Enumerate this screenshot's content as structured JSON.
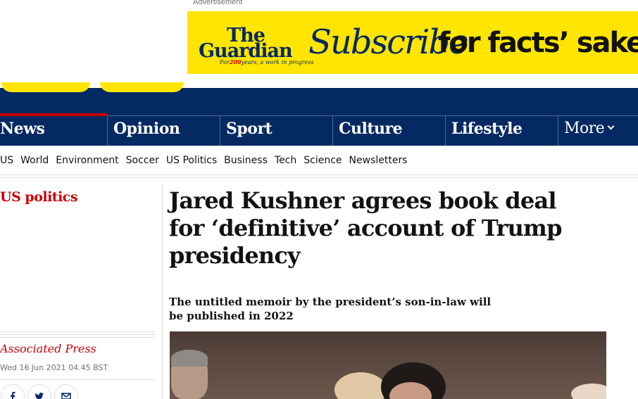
{
  "ad": {
    "label": "Advertisement",
    "logo_line1": "The",
    "logo_line2": "Guardian",
    "logo_tag_number": "200",
    "logo_tag_pre": "For",
    "logo_tag_post": "years, a work in progress",
    "headline_italic": "Subscribe",
    "headline_bold": "for facts’ sake",
    "background_color": "#ffe500"
  },
  "masthead": {
    "background_color": "#052962",
    "pillars": [
      {
        "label": "News",
        "active": true
      },
      {
        "label": "Opinion",
        "active": false
      },
      {
        "label": "Sport",
        "active": false
      },
      {
        "label": "Culture",
        "active": false
      },
      {
        "label": "Lifestyle",
        "active": false
      }
    ],
    "more_label": "More"
  },
  "subnav": {
    "items": [
      "US",
      "World",
      "Environment",
      "Soccer",
      "US Politics",
      "Business",
      "Tech",
      "Science",
      "Newsletters"
    ]
  },
  "article": {
    "section": "US politics",
    "headline": "Jared Kushner agrees book deal for ‘definitive’ account of Trump presidency",
    "standfirst": "The untitled memoir by the president’s son-in-law will be published in 2022",
    "byline": "Associated Press",
    "dateline": "Wed 16 Jun 2021 04.45 BST",
    "share_icons": [
      "facebook-icon",
      "twitter-icon",
      "email-icon"
    ],
    "accent_color": "#c70000"
  }
}
